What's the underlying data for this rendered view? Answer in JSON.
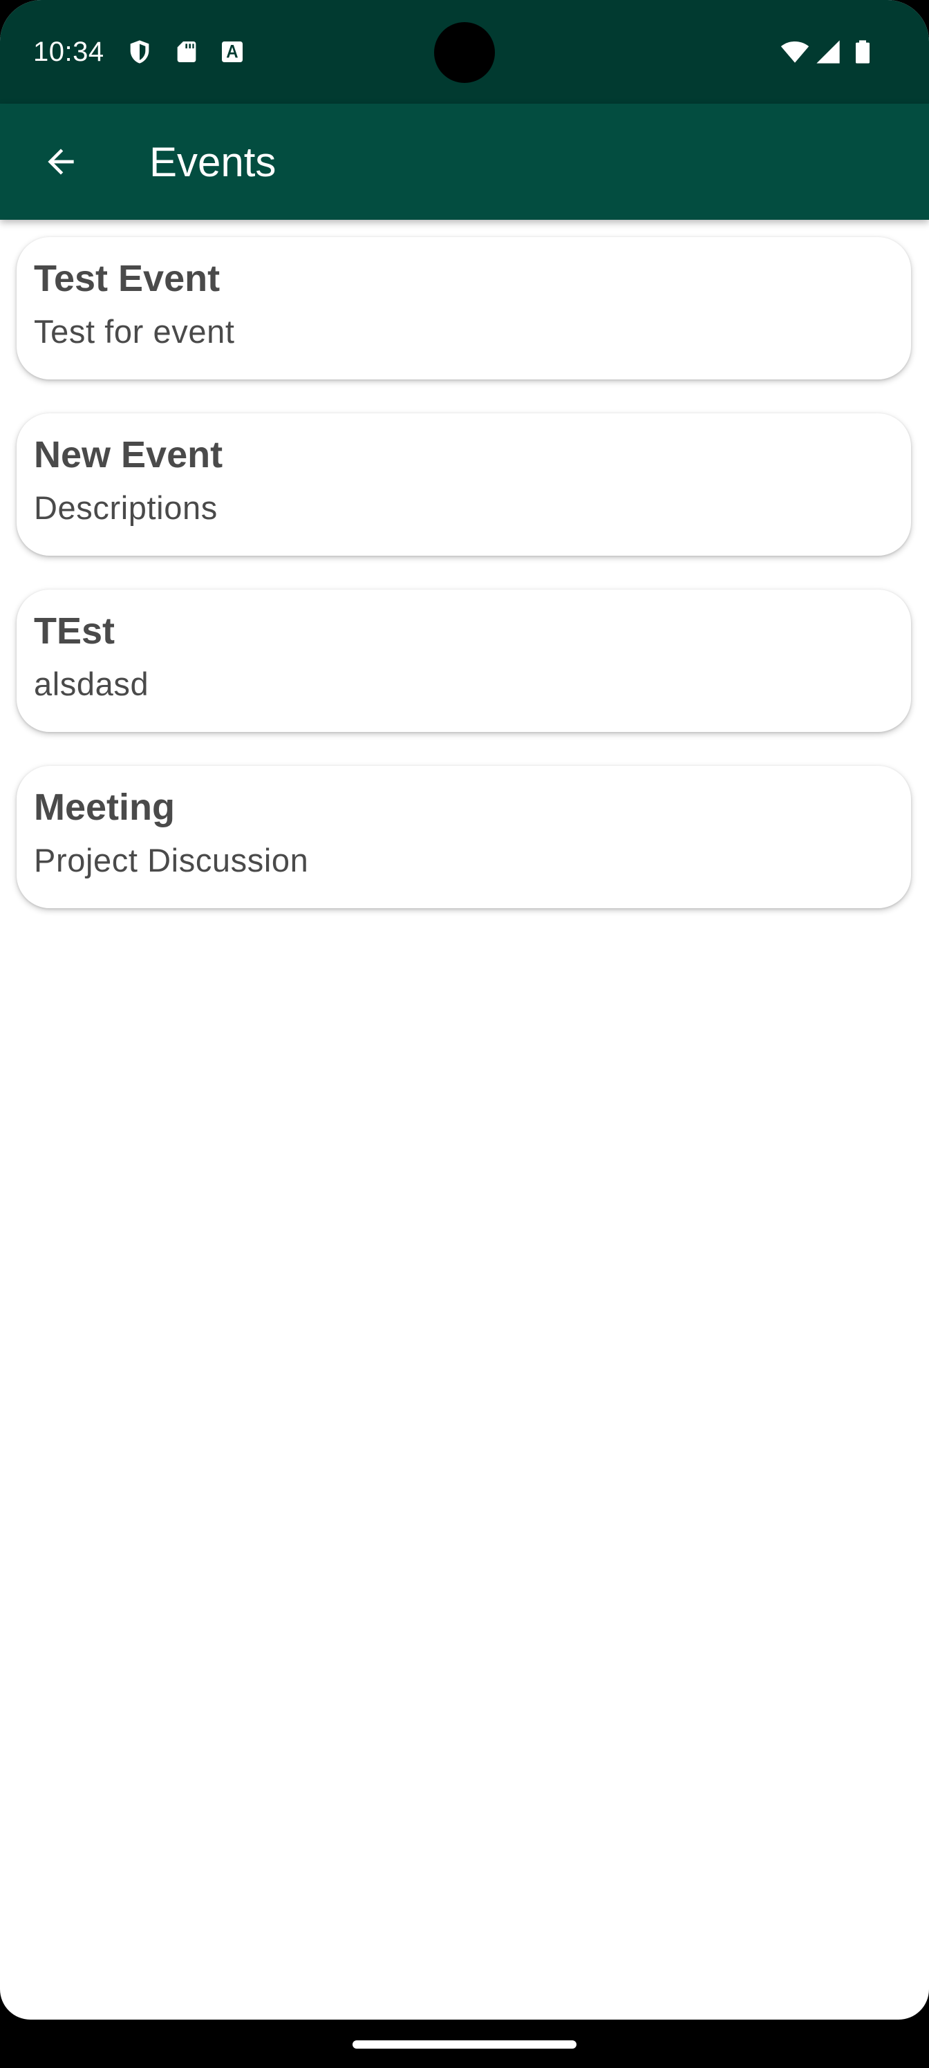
{
  "status_bar": {
    "time": "10:34",
    "left_icons": [
      "shield-icon",
      "sd-card-icon",
      "font-a-icon"
    ],
    "right_icons": [
      "wifi-icon",
      "signal-icon",
      "battery-icon"
    ],
    "background_color": "#013a30"
  },
  "app_bar": {
    "title": "Events",
    "back_icon": "arrow-back-icon",
    "background_color": "#034d40"
  },
  "events": [
    {
      "title": "Test Event",
      "description": "Test for event"
    },
    {
      "title": "New Event",
      "description": "Descriptions"
    },
    {
      "title": "TEst",
      "description": "alsdasd"
    },
    {
      "title": "Meeting",
      "description": "Project Discussion"
    }
  ],
  "colors": {
    "text": "#4a4a4a",
    "card_background": "#ffffff",
    "page_background": "#ffffff"
  }
}
